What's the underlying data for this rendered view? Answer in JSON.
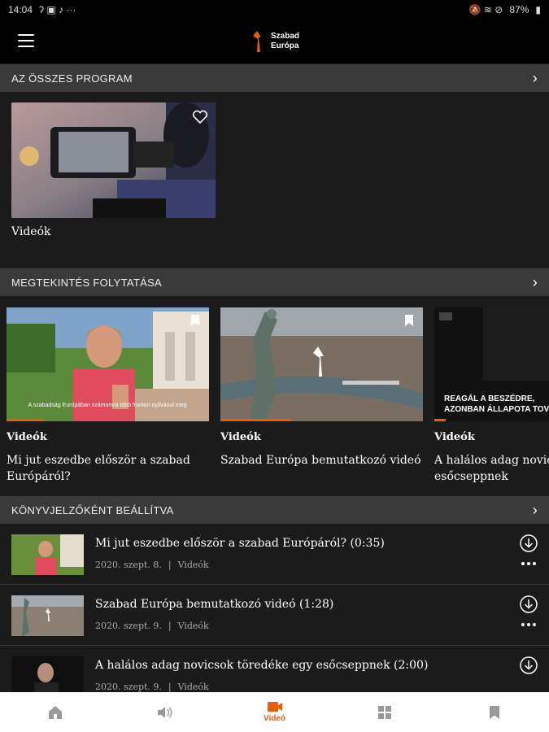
{
  "status": {
    "time": "14:04",
    "battery": "87%"
  },
  "sections": {
    "all_programs": {
      "title": "AZ ÖSSZES PROGRAM"
    },
    "continue": {
      "title": "MEGTEKINTÉS FOLYTATÁSA"
    },
    "bookmarked": {
      "title": "KÖNYVJELZŐKÉNT BEÁLLÍTVA"
    }
  },
  "program_card": {
    "label": "Videók"
  },
  "continue_items": [
    {
      "category": "Videók",
      "title_line1": "Mi jut eszedbe először a szabad",
      "title_line2": "Európáról?",
      "overlay": "A szabadság Európában számomra több fronton nyilvánul meg",
      "progress": 0.18
    },
    {
      "category": "Videók",
      "title_line1": "Szabad Európa bemutatkozó videó",
      "title_line2": "",
      "progress": 0.35
    },
    {
      "category": "Videók",
      "title_line1": "A halálos adag novicsok",
      "title_line2": "esőcseppnek",
      "overlay_line1": "REAGÁL A BESZÉDRE,",
      "overlay_line2": "AZONBAN ÁLLAPOTA TOVÁB",
      "progress": 0.1
    }
  ],
  "bookmarks": [
    {
      "title": "Mi jut eszedbe először a szabad Európáról? (0:35)",
      "date": "2020. szept. 8.",
      "category": "Videók"
    },
    {
      "title": "Szabad Európa bemutatkozó videó (1:28)",
      "date": "2020. szept. 9.",
      "category": "Videók"
    },
    {
      "title": "A halálos adag novicsok töredéke egy esőcseppnek (2:00)",
      "date": "2020. szept. 9.",
      "category": "Videók"
    }
  ],
  "logo": {
    "line1": "Szabad",
    "line2": "Európa"
  },
  "nav": {
    "video_label": "Videó"
  },
  "colors": {
    "accent": "#e85d0c"
  }
}
